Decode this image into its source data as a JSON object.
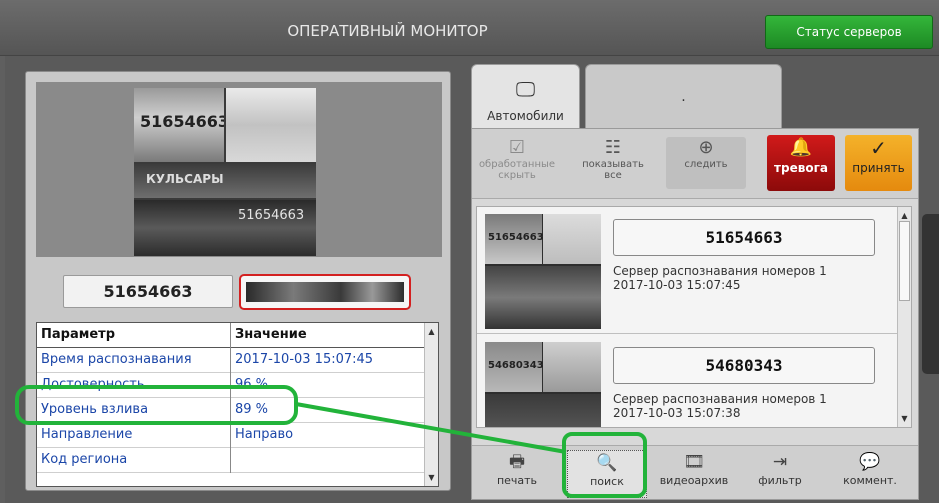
{
  "window": {
    "title": "ОПЕРАТИВНЫЙ МОНИТОР",
    "status_button": "Статус серверов"
  },
  "left_panel": {
    "recognized_number": "51654663",
    "preview_plates": [
      "51654663",
      "КУЛЬСАРЫ",
      "51654663"
    ],
    "table": {
      "headers": [
        "Параметр",
        "Значение"
      ],
      "rows": [
        [
          "Время распознавания",
          "2017-10-03 15:07:45"
        ],
        [
          "Достоверность",
          "96 %"
        ],
        [
          "Уровень взлива",
          "89 %"
        ],
        [
          "Направление",
          "Направо"
        ],
        [
          "Код региона",
          ""
        ]
      ]
    }
  },
  "tabs": [
    {
      "label": "Автомобили",
      "icon": "monitor-icon"
    },
    {
      "label": "."
    }
  ],
  "toolbar": {
    "hide_processed": "обработанные скрыть",
    "show_all": "показывать все",
    "follow": "следить",
    "alarm": "тревога",
    "accept": "принять"
  },
  "events": [
    {
      "number": "51654663",
      "server": "Сервер распознавания номеров 1",
      "time": "2017-10-03 15:07:45",
      "thumb_plate": "51654663"
    },
    {
      "number": "54680343",
      "server": "Сервер распознавания номеров 1",
      "time": "2017-10-03 15:07:38",
      "thumb_plate": "54680343"
    }
  ],
  "bottom_bar": {
    "print": "печать",
    "search": "поиск",
    "video_archive": "видеоархив",
    "filter": "фильтр",
    "comment": "коммент."
  },
  "colors": {
    "highlight": "#22b33a",
    "alarm": "#c01414",
    "accept": "#f0a020",
    "status_ok": "#22a02a"
  }
}
